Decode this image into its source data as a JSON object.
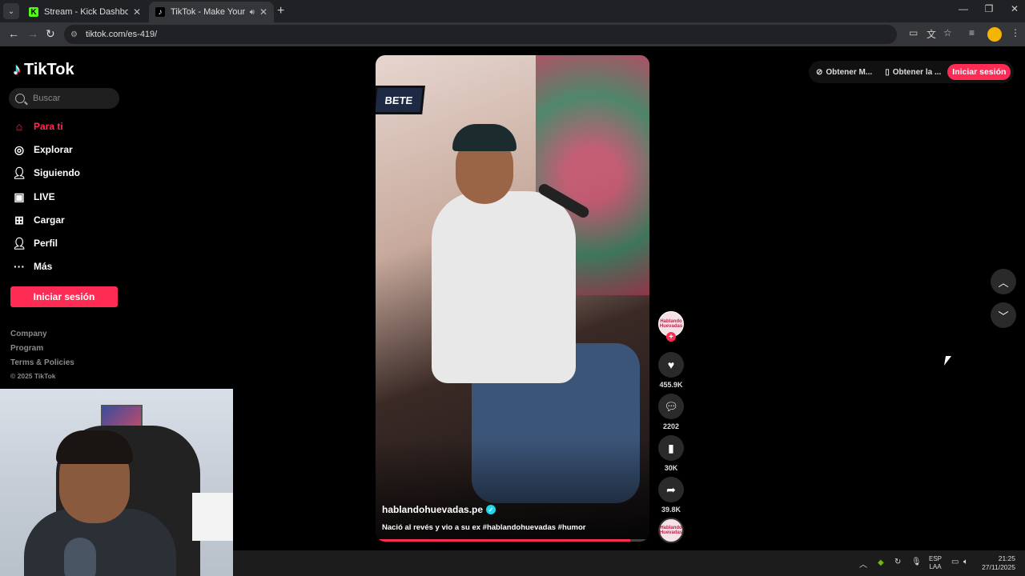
{
  "browser": {
    "tabs": [
      {
        "title": "Stream - Kick Dashboard",
        "favicon": "kick-icon",
        "active": false
      },
      {
        "title": "TikTok - Make Your Day",
        "favicon": "tiktok-icon",
        "active": true
      }
    ],
    "url": "tiktok.com/es-419/"
  },
  "sidebar": {
    "logo": "TikTok",
    "search_placeholder": "Buscar",
    "items": [
      {
        "label": "Para ti",
        "icon": "home-icon",
        "active": true
      },
      {
        "label": "Explorar",
        "icon": "compass-icon",
        "active": false
      },
      {
        "label": "Siguiendo",
        "icon": "following-icon",
        "active": false
      },
      {
        "label": "LIVE",
        "icon": "live-icon",
        "active": false
      },
      {
        "label": "Cargar",
        "icon": "upload-icon",
        "active": false
      },
      {
        "label": "Perfil",
        "icon": "profile-icon",
        "active": false
      },
      {
        "label": "Más",
        "icon": "more-icon",
        "active": false
      }
    ],
    "login_label": "Iniciar sesión",
    "footer": {
      "links": [
        "Company",
        "Program",
        "Terms & Policies"
      ],
      "copyright": "© 2025 TikTok"
    }
  },
  "video": {
    "author": "hablandohuevadas.pe",
    "verified": true,
    "caption": "Nació al revés y vio a su ex #hablandohuevadas #humor",
    "overlay_badge": "BETE",
    "progress": 0.94
  },
  "actions": {
    "avatar_text": "Hablando Huevadas",
    "likes": "455.9K",
    "comments": "2202",
    "saves": "30K",
    "shares": "39.8K"
  },
  "topright": {
    "get_coins": "Obtener M...",
    "get_app": "Obtener la ...",
    "login": "Iniciar sesión"
  },
  "taskbar": {
    "lang_line1": "ESP",
    "lang_line2": "LAA",
    "time": "21:25",
    "date": "27/11/2025"
  },
  "colors": {
    "accent": "#fe2c55",
    "background": "#000000",
    "verified": "#20d5ec"
  }
}
